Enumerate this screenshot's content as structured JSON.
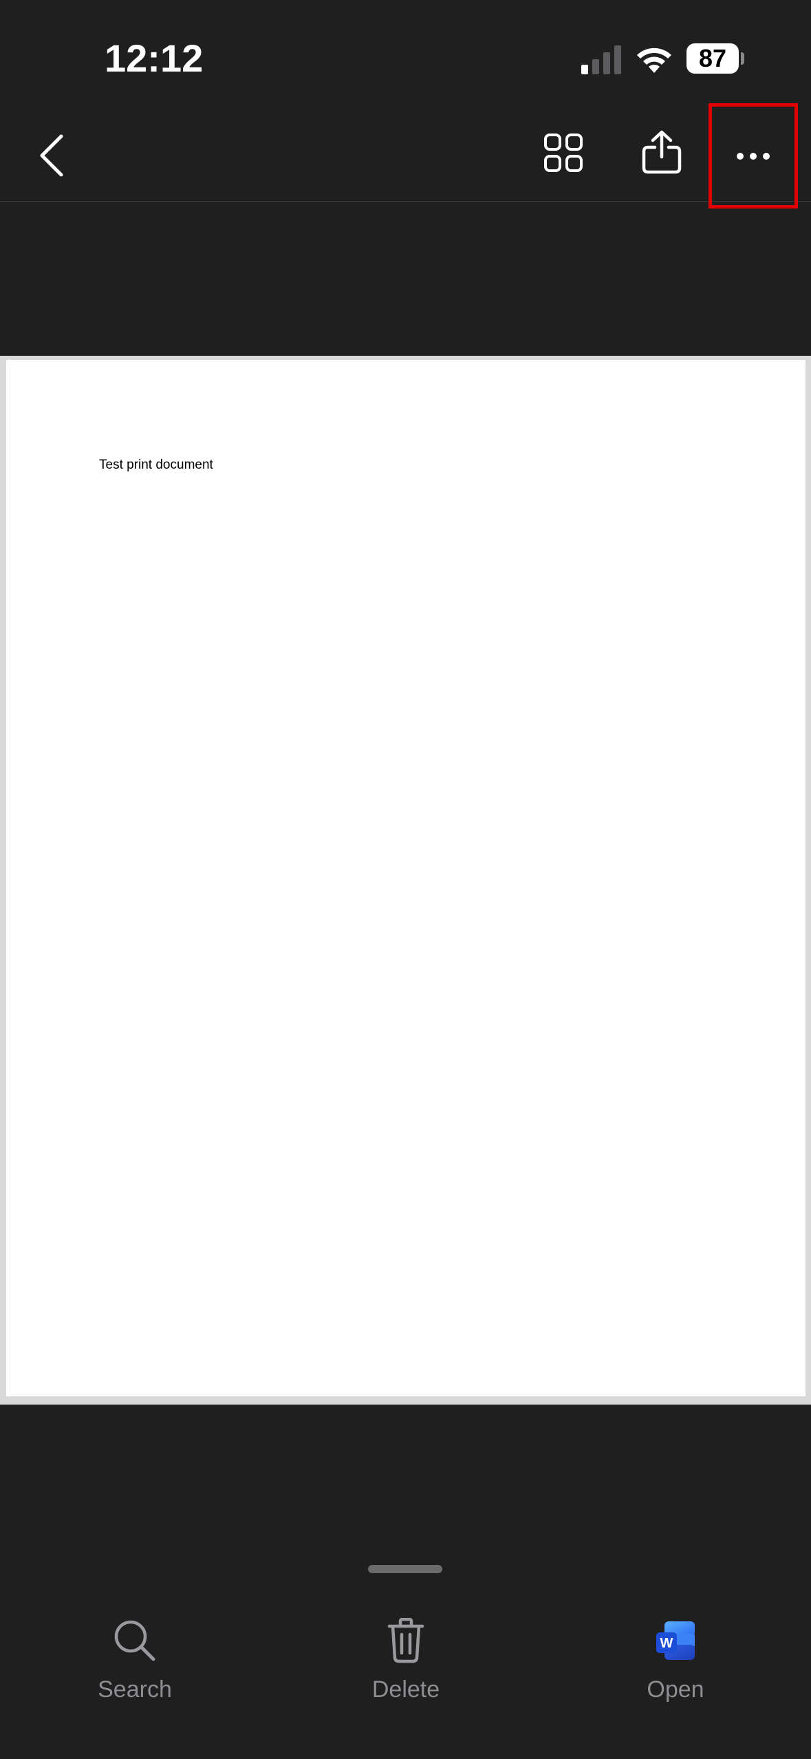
{
  "status_bar": {
    "time": "12:12",
    "battery": "87"
  },
  "toolbar": {
    "back_icon": "chevron-left-icon",
    "grid_icon": "grid-icon",
    "share_icon": "share-icon",
    "more_icon": "more-horizontal-icon",
    "highlight_color": "#e00000"
  },
  "document": {
    "text": "Test print document"
  },
  "bottom_bar": {
    "search_label": "Search",
    "delete_label": "Delete",
    "open_label": "Open"
  },
  "colors": {
    "background": "#1f1f20",
    "word_blue": "#2b5fe8"
  }
}
